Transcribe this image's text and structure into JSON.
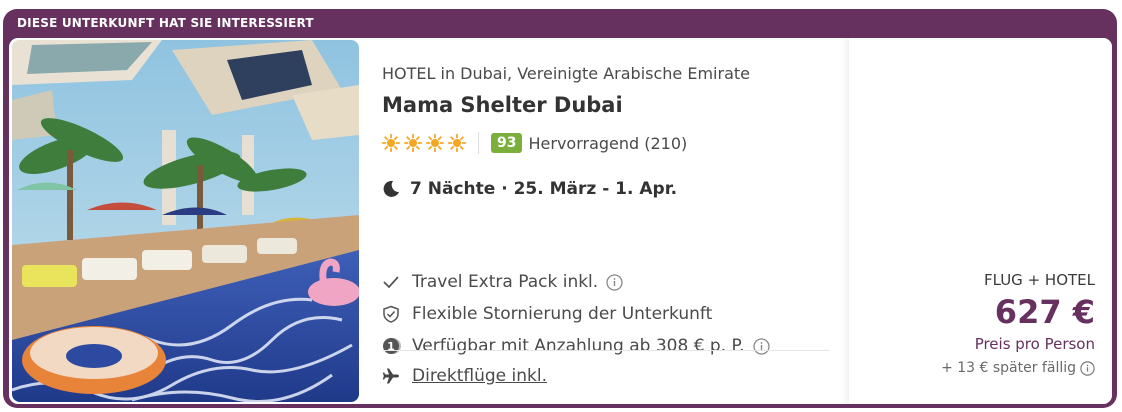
{
  "banner": {
    "label": "DIESE UNTERKUNFT HAT SIE INTERESSIERT"
  },
  "hotel": {
    "location": "HOTEL in Dubai, Vereinigte Arabische Emirate",
    "name": "Mama Shelter Dubai",
    "sun_rating": 4,
    "score": "93",
    "score_label": "Hervorragend (210)"
  },
  "trip": {
    "summary": "7 Nächte · 25. März - 1. Apr."
  },
  "features": [
    {
      "icon": "check-icon",
      "text": "Travel Extra Pack inkl."
    },
    {
      "icon": "shield-icon",
      "text": "Flexible Stornierung der Unterkunft"
    },
    {
      "icon": "deposit-icon",
      "text": "Verfügbar mit Anzahlung ab 308 € p. P."
    }
  ],
  "flight": {
    "icon": "airplane-icon",
    "text": "Direktflüge inkl."
  },
  "pricing": {
    "package": "FLUG + HOTEL",
    "price": "627 €",
    "per_person": "Preis pro Person",
    "later": "+ 13 € später fällig"
  },
  "colors": {
    "brand": "#66305f",
    "score_green": "#7cae3b",
    "sun": "#f5a623"
  }
}
